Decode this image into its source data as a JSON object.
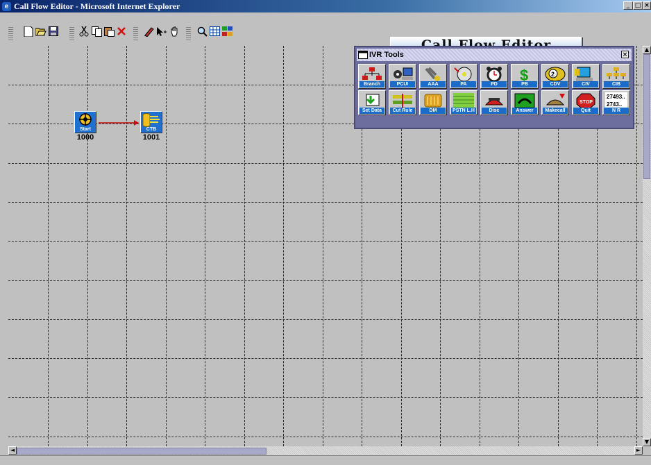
{
  "window": {
    "title": "Call Flow Editor - Microsoft Internet Explorer",
    "controls": [
      "minimize",
      "maximize",
      "close"
    ]
  },
  "toolbar": {
    "banner": "Call Flow Editor",
    "groups": [
      {
        "name": "file",
        "icons": [
          "new-icon",
          "open-icon",
          "save-icon"
        ]
      },
      {
        "name": "edit",
        "icons": [
          "cut-icon",
          "copy-icon",
          "paste-icon",
          "delete-icon"
        ]
      },
      {
        "name": "draw",
        "icons": [
          "pencil-icon",
          "select-arrow-icon",
          "hand-icon"
        ]
      },
      {
        "name": "view",
        "icons": [
          "zoom-icon",
          "grid-icon",
          "layout-icon"
        ]
      }
    ]
  },
  "palette": {
    "title": "IVR Tools",
    "row1": [
      {
        "label": "Branch",
        "icon": "branch-icon",
        "color": "#d01818"
      },
      {
        "label": "PCUI",
        "icon": "pcui-icon",
        "color": "#3060c0"
      },
      {
        "label": "AAA",
        "icon": "aaa-icon",
        "color": "#6a6a6a"
      },
      {
        "label": "PA",
        "icon": "pa-icon",
        "color": "#e0e020"
      },
      {
        "label": "PD",
        "icon": "pd-icon",
        "color": "#202020"
      },
      {
        "label": "PB",
        "icon": "pb-icon",
        "color": "#10a010"
      },
      {
        "label": "CDV",
        "icon": "cdv-icon",
        "color": "#e0c020"
      },
      {
        "label": "CIV",
        "icon": "civ-icon",
        "color": "#20a0e0"
      },
      {
        "label": "CIB",
        "icon": "cib-icon",
        "color": "#e0b020"
      }
    ],
    "row2": [
      {
        "label": "Set Data",
        "icon": "set-data-icon",
        "color": "#20a020"
      },
      {
        "label": "Cut Rule",
        "icon": "cut-rule-icon",
        "color": "#d0c020"
      },
      {
        "label": "DM",
        "icon": "dm-icon",
        "color": "#e0a020"
      },
      {
        "label": "PSTN L.H",
        "icon": "pstn-icon",
        "color": "#80d040"
      },
      {
        "label": "Disc",
        "icon": "disc-icon",
        "color": "#d02020"
      },
      {
        "label": "Answer",
        "icon": "answer-icon",
        "color": "#20a020"
      },
      {
        "label": "Makecall",
        "icon": "makecall-icon",
        "color": "#a08040"
      },
      {
        "label": "Quit",
        "icon": "quit-icon",
        "color": "#d02020"
      },
      {
        "label": "N R",
        "icon": "nr-icon",
        "color": "#e0e0e0",
        "text1": "27493..",
        "text2": "2743.."
      }
    ]
  },
  "nodes": [
    {
      "id": "1000",
      "label": "Start",
      "icon": "start-icon"
    },
    {
      "id": "1001",
      "label": "CTB",
      "icon": "ctb-icon"
    }
  ]
}
